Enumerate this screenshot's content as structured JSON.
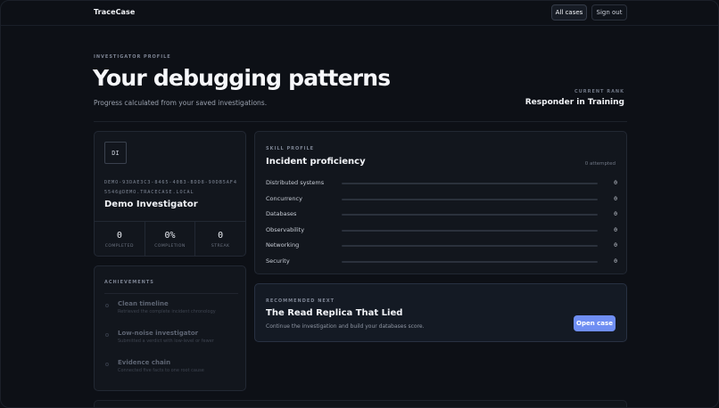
{
  "header": {
    "brand": "TraceCase",
    "nav": [
      {
        "label": "All cases",
        "active": true
      },
      {
        "label": "Sign out",
        "active": false
      }
    ]
  },
  "hero": {
    "eyebrow": "INVESTIGATOR PROFILE",
    "title": "Your debugging patterns",
    "subtitle": "Progress calculated from your saved investigations.",
    "rank_label": "CURRENT RANK",
    "rank_value": "Responder in Training"
  },
  "profile": {
    "initials": "DI",
    "id": "DEMO-93DAE3C3-8465-40B3-BDD8-90DB5AF45546@DEMO.TRACECASE.LOCAL",
    "name": "Demo Investigator",
    "stats": [
      {
        "value": "0",
        "label": "COMPLETED"
      },
      {
        "value": "0%",
        "label": "COMPLETION"
      },
      {
        "value": "0",
        "label": "STREAK"
      }
    ]
  },
  "achievements": {
    "title": "ACHIEVEMENTS",
    "items": [
      {
        "name": "Clean timeline",
        "desc": "Retrieved the complete incident chronology"
      },
      {
        "name": "Low-noise investigator",
        "desc": "Submitted a verdict with low-level or fewer"
      },
      {
        "name": "Evidence chain",
        "desc": "Connected five facts to one root cause"
      }
    ]
  },
  "skills": {
    "eyebrow": "SKILL PROFILE",
    "title": "Incident proficiency",
    "attempted": "0 attempted",
    "accent": "#6e8ef0",
    "items": [
      {
        "name": "Distributed systems",
        "value": "0",
        "fraction": 0
      },
      {
        "name": "Concurrency",
        "value": "0",
        "fraction": 0
      },
      {
        "name": "Databases",
        "value": "0",
        "fraction": 0
      },
      {
        "name": "Observability",
        "value": "0",
        "fraction": 0
      },
      {
        "name": "Networking",
        "value": "0",
        "fraction": 0
      },
      {
        "name": "Security",
        "value": "0",
        "fraction": 0
      }
    ]
  },
  "recommended": {
    "eyebrow": "RECOMMENDED NEXT",
    "title": "The Read Replica That Lied",
    "subtitle": "Continue the investigation and build your databases score.",
    "button_label": "Open case",
    "button_color": "#6f8ef3"
  }
}
